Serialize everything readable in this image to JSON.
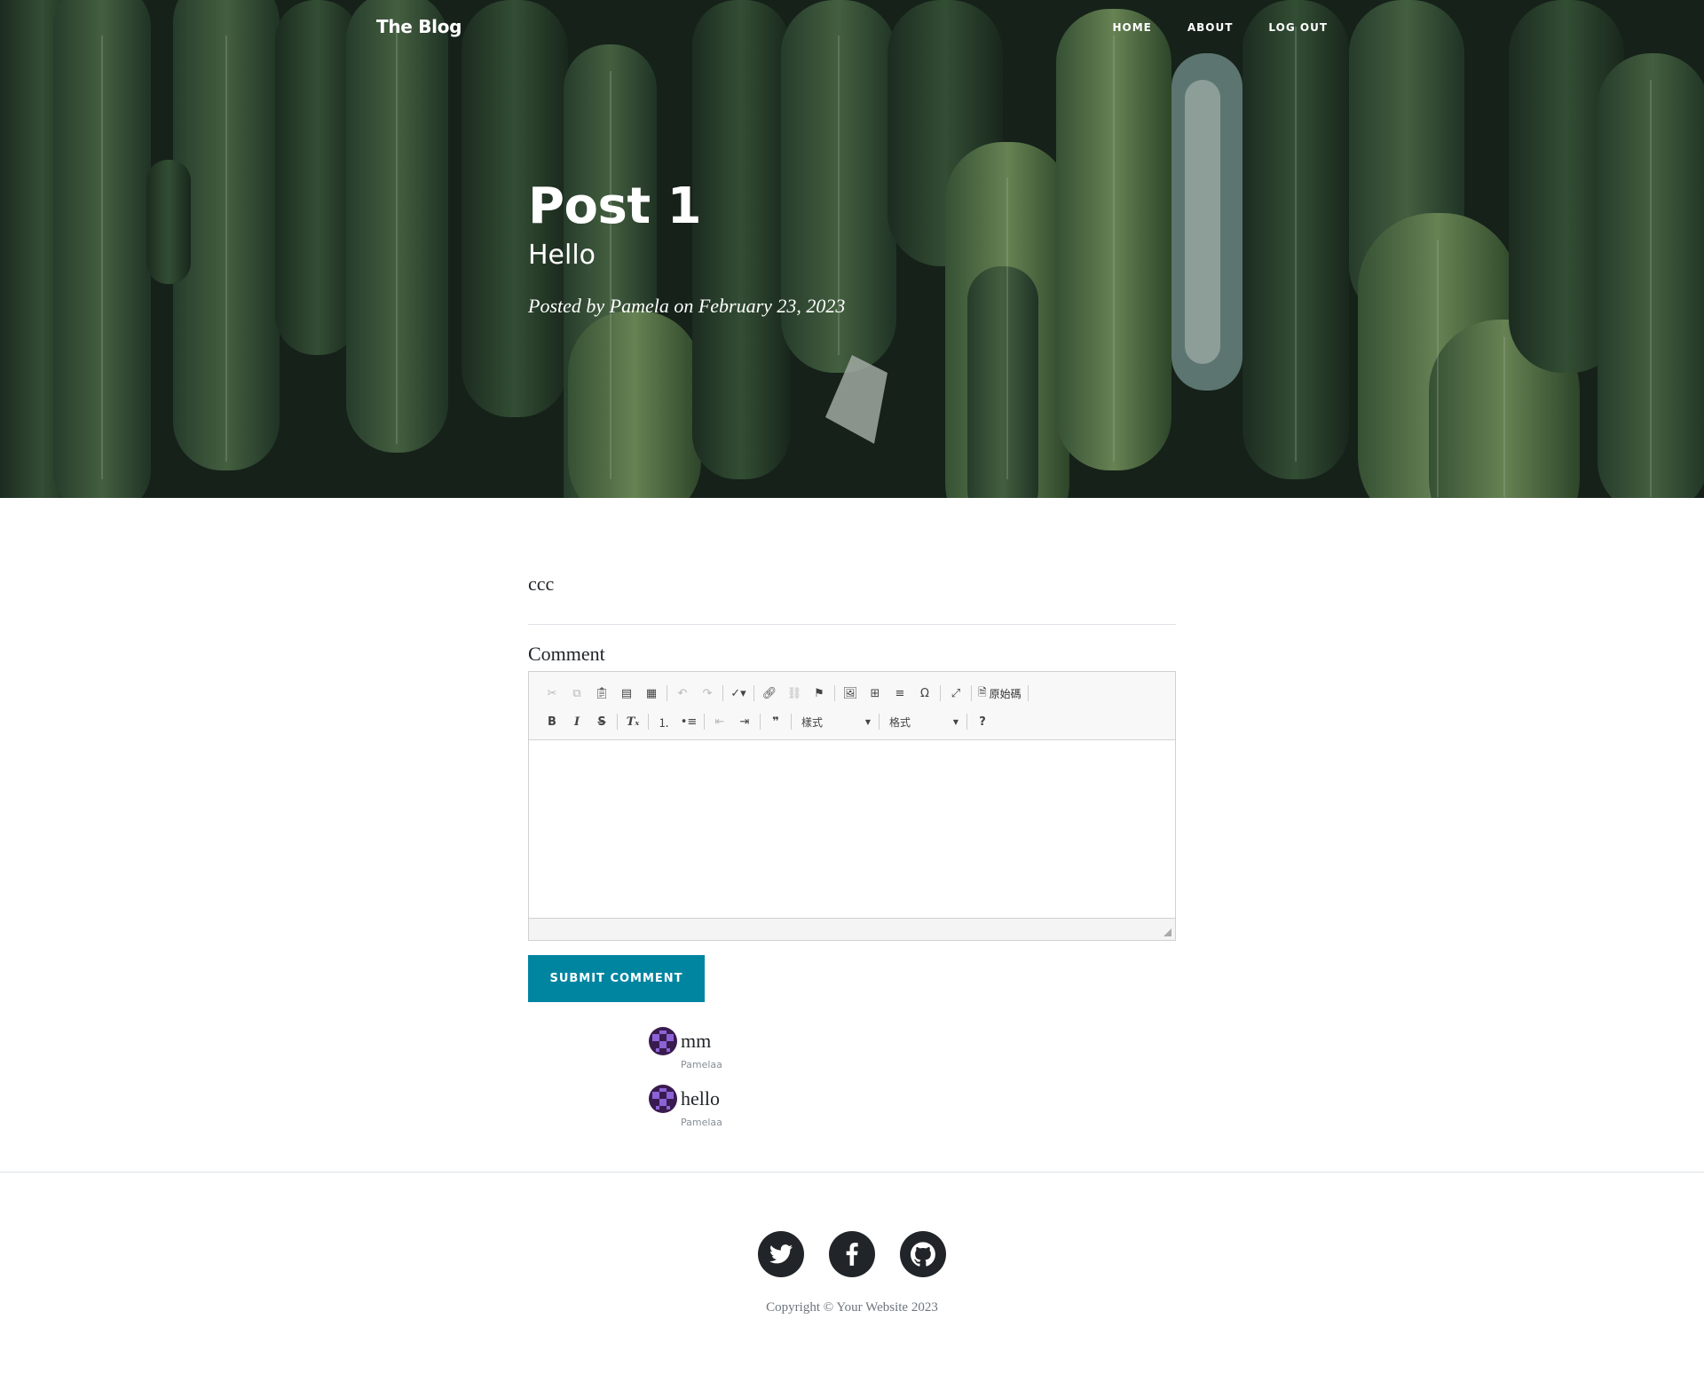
{
  "navbar": {
    "brand": "The Blog",
    "links": [
      "HOME",
      "ABOUT",
      "LOG OUT"
    ]
  },
  "post": {
    "title": "Post 1",
    "subtitle": "Hello",
    "meta": "Posted by Pamela on February 23, 2023",
    "body": "ccc"
  },
  "comment_form": {
    "label": "Comment",
    "editor": {
      "toolbar_row1": [
        "cut-icon",
        "copy-icon",
        "paste-icon",
        "paste-text-icon",
        "paste-word-icon",
        "undo-icon",
        "redo-icon",
        "spellcheck-icon",
        "link-icon",
        "unlink-icon",
        "anchor-flag-icon",
        "image-icon",
        "table-icon",
        "horizontal-rule-icon",
        "special-char-icon",
        "maximize-icon",
        "source-icon"
      ],
      "source_label": "原始碼",
      "toolbar_row2": [
        "bold-icon",
        "italic-icon",
        "strike-icon",
        "remove-format-icon",
        "numbered-list-icon",
        "bulleted-list-icon",
        "outdent-icon",
        "indent-icon",
        "blockquote-icon",
        "help-icon"
      ],
      "styles_label": "樣式",
      "format_label": "格式"
    },
    "submit_label": "SUBMIT COMMENT"
  },
  "comments": [
    {
      "text": "mm",
      "author": "Pamelaa"
    },
    {
      "text": "hello",
      "author": "Pamelaa"
    }
  ],
  "footer": {
    "socials": [
      "twitter-icon",
      "facebook-icon",
      "github-icon"
    ],
    "copyright": "Copyright © Your Website 2023"
  },
  "colors": {
    "accent": "#0085a1",
    "text": "#212529",
    "muted": "#868e96",
    "avatar_bg": "#3a1b4f",
    "avatar_fg": "#8c63d6"
  }
}
